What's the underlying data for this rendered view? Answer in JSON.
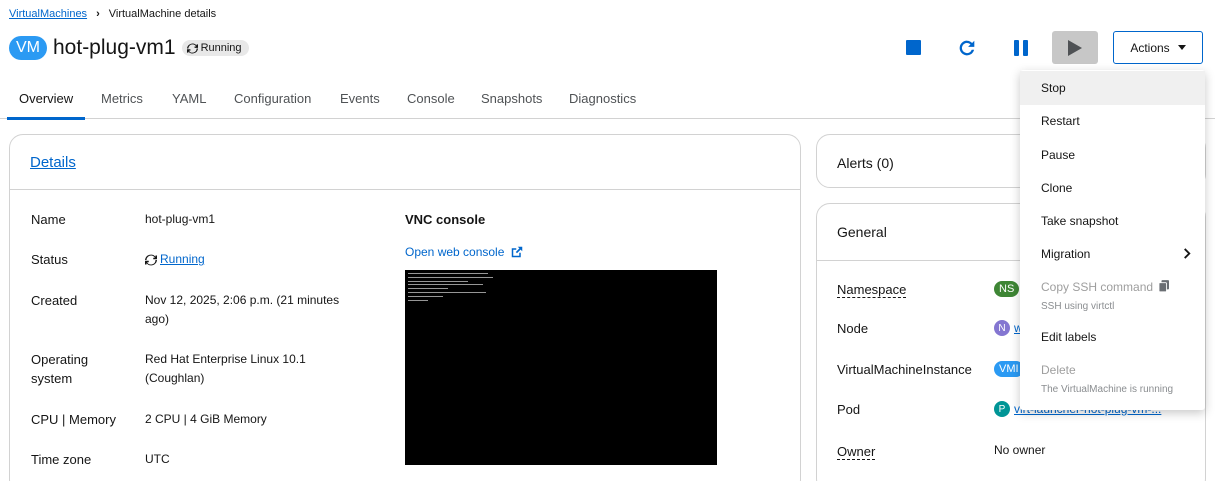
{
  "breadcrumb": {
    "parent": "VirtualMachines",
    "current": "VirtualMachine details"
  },
  "header": {
    "badge": "VM",
    "name": "hot-plug-vm1",
    "status": "Running"
  },
  "toolbar": {
    "actions_label": "Actions"
  },
  "tabs": [
    "Overview",
    "Metrics",
    "YAML",
    "Configuration",
    "Events",
    "Console",
    "Snapshots",
    "Diagnostics"
  ],
  "details": {
    "title": "Details",
    "fields": {
      "name_label": "Name",
      "name_value": "hot-plug-vm1",
      "status_label": "Status",
      "status_value": "Running",
      "created_label": "Created",
      "created_value": "Nov 12, 2025, 2:06 p.m. (21 minutes ago)",
      "os_label": "Operating system",
      "os_value": "Red Hat Enterprise Linux 10.1 (Coughlan)",
      "cpu_label": "CPU | Memory",
      "cpu_value": "2 CPU | 4 GiB Memory",
      "tz_label": "Time zone",
      "tz_value": "UTC"
    },
    "vnc": {
      "title": "VNC console",
      "open_link": "Open web console"
    }
  },
  "alerts": {
    "title": "Alerts (0)"
  },
  "general": {
    "title": "General",
    "namespace_label": "Namespace",
    "namespace_badge": "NS",
    "node_label": "Node",
    "node_badge": "N",
    "node_value": "w",
    "vmi_label": "VirtualMachineInstance",
    "vmi_badge": "VMI",
    "pod_label": "Pod",
    "pod_badge": "P",
    "pod_value": "virt-launcher-hot-plug-vm-...",
    "owner_label": "Owner",
    "owner_value": "No owner"
  },
  "menu": {
    "stop": "Stop",
    "restart": "Restart",
    "pause": "Pause",
    "clone": "Clone",
    "snapshot": "Take snapshot",
    "migration": "Migration",
    "copy_ssh": "Copy SSH command",
    "copy_ssh_desc": "SSH using virtctl",
    "edit_labels": "Edit labels",
    "delete": "Delete",
    "delete_desc": "The VirtualMachine is running"
  },
  "colors": {
    "link": "#0066cc",
    "vm_badge": "#2b9af3",
    "ns_badge": "#3e8635",
    "node_badge": "#8476d1",
    "vmi_badge": "#2b9af3",
    "pod_badge": "#009596"
  }
}
